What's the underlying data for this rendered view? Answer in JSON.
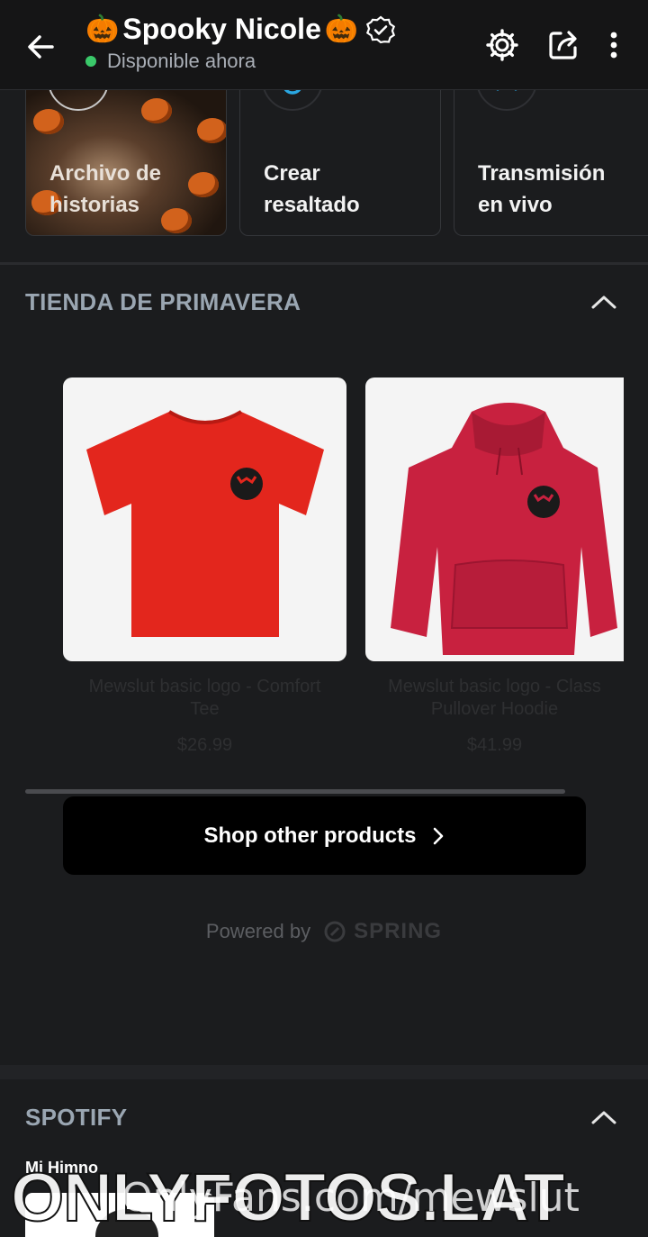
{
  "header": {
    "title": "Spooky Nicole",
    "emoji": "🎃",
    "status": "Disponible ahora",
    "status_color": "#3ac96a"
  },
  "highlights": [
    {
      "label_line1": "Archivo de",
      "label_line2": "historias",
      "icon": "story-archive-icon"
    },
    {
      "label_line1": "Crear",
      "label_line2": "resaltado",
      "icon": "add-highlight-icon"
    },
    {
      "label_line1": "Transmisión",
      "label_line2": "en vivo",
      "icon": "live-stream-icon"
    }
  ],
  "shop": {
    "section_title": "TIENDA DE PRIMAVERA",
    "products": [
      {
        "name_line1": "Mewslut basic logo - Comfort",
        "name_line2": "Tee",
        "price": "$26.99",
        "color": "#e3261d",
        "kind": "t-shirt"
      },
      {
        "name_line1": "Mewslut basic logo - Class",
        "name_line2": "Pullover Hoodie",
        "price": "$41.99",
        "color": "#c8213f",
        "kind": "hoodie"
      }
    ],
    "cta_label": "Shop other products",
    "powered_by": "Powered by",
    "brand": "SPRING"
  },
  "spotify": {
    "section_title": "SPOTIFY",
    "subtitle": "Mi Himno"
  },
  "watermark": {
    "primary": "ONLYFOTOS.LAT",
    "secondary": "OnlyFans.com/mewslut"
  }
}
